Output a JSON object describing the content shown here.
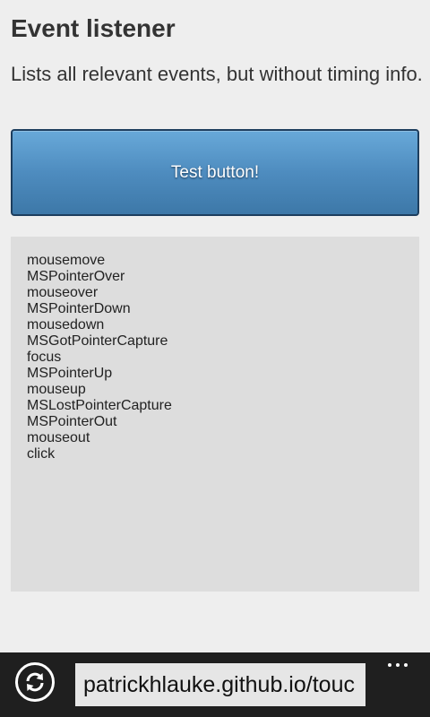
{
  "page": {
    "title": "Event listener",
    "description": "Lists all relevant events, but without timing info."
  },
  "button": {
    "label": "Test button!"
  },
  "events": [
    "mousemove",
    "MSPointerOver",
    "mouseover",
    "MSPointerDown",
    "mousedown",
    "MSGotPointerCapture",
    "focus",
    "MSPointerUp",
    "mouseup",
    "MSLostPointerCapture",
    "MSPointerOut",
    "mouseout",
    "click"
  ],
  "browser": {
    "url": "patrickhlauke.github.io/touc",
    "refresh_icon": "refresh-icon",
    "more_icon": "more-icon"
  },
  "colors": {
    "page_bg": "#eeeeee",
    "button_accent": "#4e8cbf",
    "log_bg": "#dddddd",
    "appbar_bg": "#1f1f1f"
  }
}
